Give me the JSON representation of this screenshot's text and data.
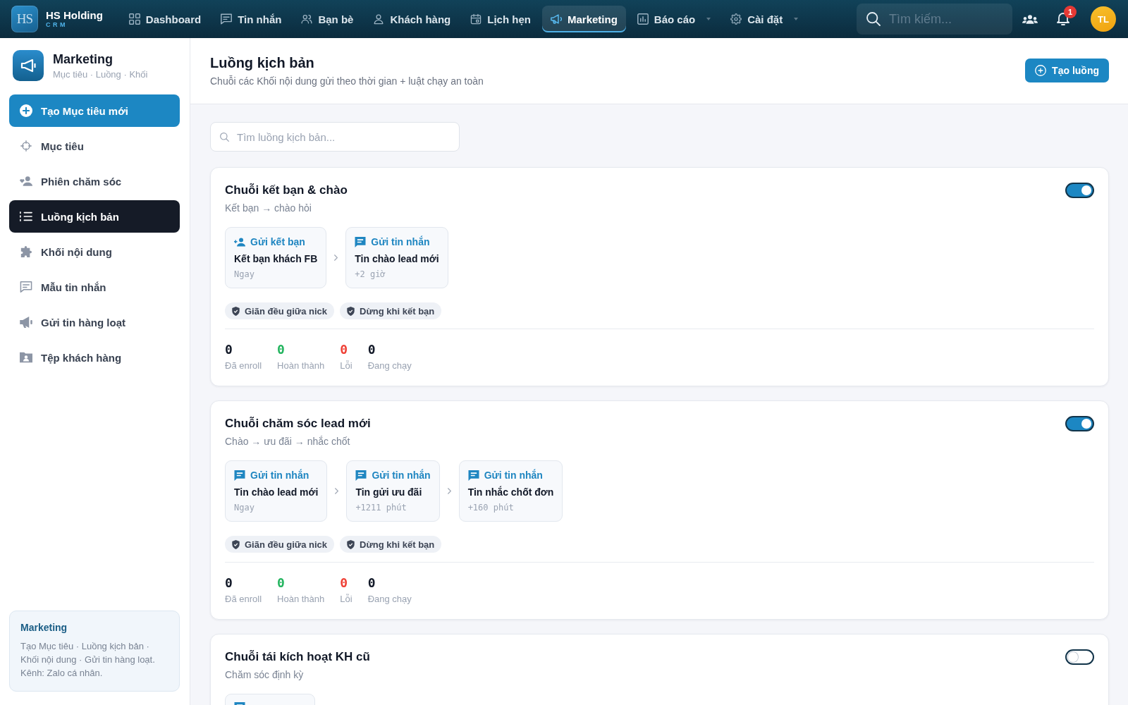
{
  "topbar": {
    "brand": {
      "logo": "HS",
      "name": "HS Holding",
      "tagline": "CRM"
    },
    "nav": [
      {
        "label": "Dashboard",
        "kind": "link",
        "selected": false
      },
      {
        "label": "Tin nhắn",
        "kind": "link",
        "selected": false
      },
      {
        "label": "Bạn bè",
        "kind": "link",
        "selected": false
      },
      {
        "label": "Khách hàng",
        "kind": "link",
        "selected": false
      },
      {
        "label": "Lịch hẹn",
        "kind": "link",
        "selected": false
      },
      {
        "label": "Marketing",
        "kind": "link",
        "selected": true
      },
      {
        "label": "Báo cáo",
        "kind": "dropdown",
        "selected": false
      },
      {
        "label": "Cài đặt",
        "kind": "dropdown",
        "selected": false
      }
    ],
    "search": {
      "placeholder": "Tìm kiếm..."
    },
    "notifications": {
      "badge": "1"
    },
    "avatar": {
      "initials": "TL"
    }
  },
  "sidebar": {
    "title": "Marketing",
    "subtitle": "Mục tiêu · Luồng · Khối",
    "create_button": "Tạo Mục tiêu mới",
    "items": [
      {
        "label": "Mục tiêu",
        "selected": false
      },
      {
        "label": "Phiên chăm sóc",
        "selected": false
      },
      {
        "label": "Luồng kịch bản",
        "selected": true
      },
      {
        "label": "Khối nội dung",
        "selected": false
      },
      {
        "label": "Mẫu tin nhắn",
        "selected": false
      },
      {
        "label": "Gửi tin hàng loạt",
        "selected": false
      },
      {
        "label": "Tệp khách hàng",
        "selected": false
      }
    ],
    "info_card": {
      "title": "Marketing",
      "description": "Tạo Mục tiêu · Luồng kịch bản · Khối nội dung · Gửi tin hàng loạt.",
      "channel": "Kênh: Zalo cá nhân."
    }
  },
  "page": {
    "title": "Luồng kịch bản",
    "subtitle": "Chuỗi các Khối nội dung gửi theo thời gian + luật chạy an toàn",
    "create_button": "Tạo luồng",
    "search": {
      "placeholder": "Tìm luồng kịch bản..."
    }
  },
  "flows": [
    {
      "title": "Chuỗi kết bạn & chào",
      "subtitle": "Kết bạn → chào hỏi",
      "enabled": true,
      "steps": [
        {
          "kind": "friend_request",
          "action": "Gửi kết bạn",
          "name": "Kết bạn khách FB",
          "delay": "Ngay"
        },
        {
          "kind": "message",
          "action": "Gửi tin nhắn",
          "name": "Tin chào lead mới",
          "delay": "+2 giờ"
        }
      ],
      "rules": [
        "Giãn đều giữa nick",
        "Dừng khi kết bạn"
      ],
      "stats": [
        {
          "value": "0",
          "label": "Đã enroll",
          "color": "#111827"
        },
        {
          "value": "0",
          "label": "Hoàn thành",
          "color": "#22b45e"
        },
        {
          "value": "0",
          "label": "Lỗi",
          "color": "#ef4136"
        },
        {
          "value": "0",
          "label": "Đang chạy",
          "color": "#111827"
        }
      ]
    },
    {
      "title": "Chuỗi chăm sóc lead mới",
      "subtitle": "Chào → ưu đãi → nhắc chốt",
      "enabled": true,
      "steps": [
        {
          "kind": "message",
          "action": "Gửi tin nhắn",
          "name": "Tin chào lead mới",
          "delay": "Ngay"
        },
        {
          "kind": "message",
          "action": "Gửi tin nhắn",
          "name": "Tin gửi ưu đãi",
          "delay": "+1211 phút"
        },
        {
          "kind": "message",
          "action": "Gửi tin nhắn",
          "name": "Tin nhắc chốt đơn",
          "delay": "+160 phút"
        }
      ],
      "rules": [
        "Giãn đều giữa nick",
        "Dừng khi kết bạn"
      ],
      "stats": [
        {
          "value": "0",
          "label": "Đã enroll",
          "color": "#111827"
        },
        {
          "value": "0",
          "label": "Hoàn thành",
          "color": "#22b45e"
        },
        {
          "value": "0",
          "label": "Lỗi",
          "color": "#ef4136"
        },
        {
          "value": "0",
          "label": "Đang chạy",
          "color": "#111827"
        }
      ]
    },
    {
      "title": "Chuỗi tái kích hoạt KH cũ",
      "subtitle": "Chăm sóc định kỳ",
      "enabled": false,
      "steps": [
        {
          "kind": "message"
        }
      ]
    }
  ]
}
